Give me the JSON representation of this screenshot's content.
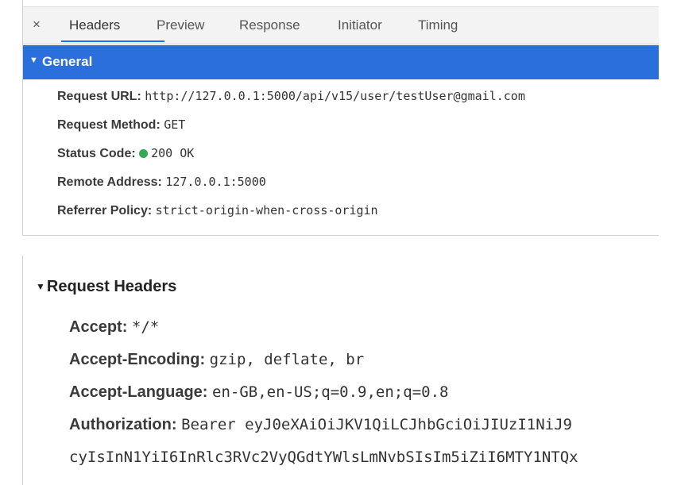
{
  "tabs": {
    "close_glyph": "×",
    "items": [
      "Headers",
      "Preview",
      "Response",
      "Initiator",
      "Timing"
    ],
    "active_index": 0
  },
  "general": {
    "title": "General",
    "rows": [
      {
        "key": "Request URL:",
        "value": "http://127.0.0.1:5000/api/v15/user/testUser@gmail.com"
      },
      {
        "key": "Request Method:",
        "value": "GET"
      },
      {
        "key": "Status Code:",
        "value": "200 OK",
        "status_color": "#34a853"
      },
      {
        "key": "Remote Address:",
        "value": "127.0.0.1:5000"
      },
      {
        "key": "Referrer Policy:",
        "value": "strict-origin-when-cross-origin"
      }
    ]
  },
  "request_headers": {
    "title": "Request Headers",
    "rows": [
      {
        "key": "Accept:",
        "value": "*/*"
      },
      {
        "key": "Accept-Encoding:",
        "value": "gzip, deflate, br"
      },
      {
        "key": "Accept-Language:",
        "value": "en-GB,en-US;q=0.9,en;q=0.8"
      },
      {
        "key": "Authorization:",
        "value": "Bearer eyJ0eXAiOiJKV1QiLCJhbGciOiJIUzI1NiJ9"
      },
      {
        "key": "",
        "value": "cyIsInN1YiI6InRlc3RVc2VyQGdtYWlsLmNvbSIsIm5iZiI6MTY1NTQx"
      }
    ]
  },
  "colors": {
    "accent": "#2a6fdb",
    "tab_underline": "#1a73e8",
    "status_ok": "#34a853"
  }
}
